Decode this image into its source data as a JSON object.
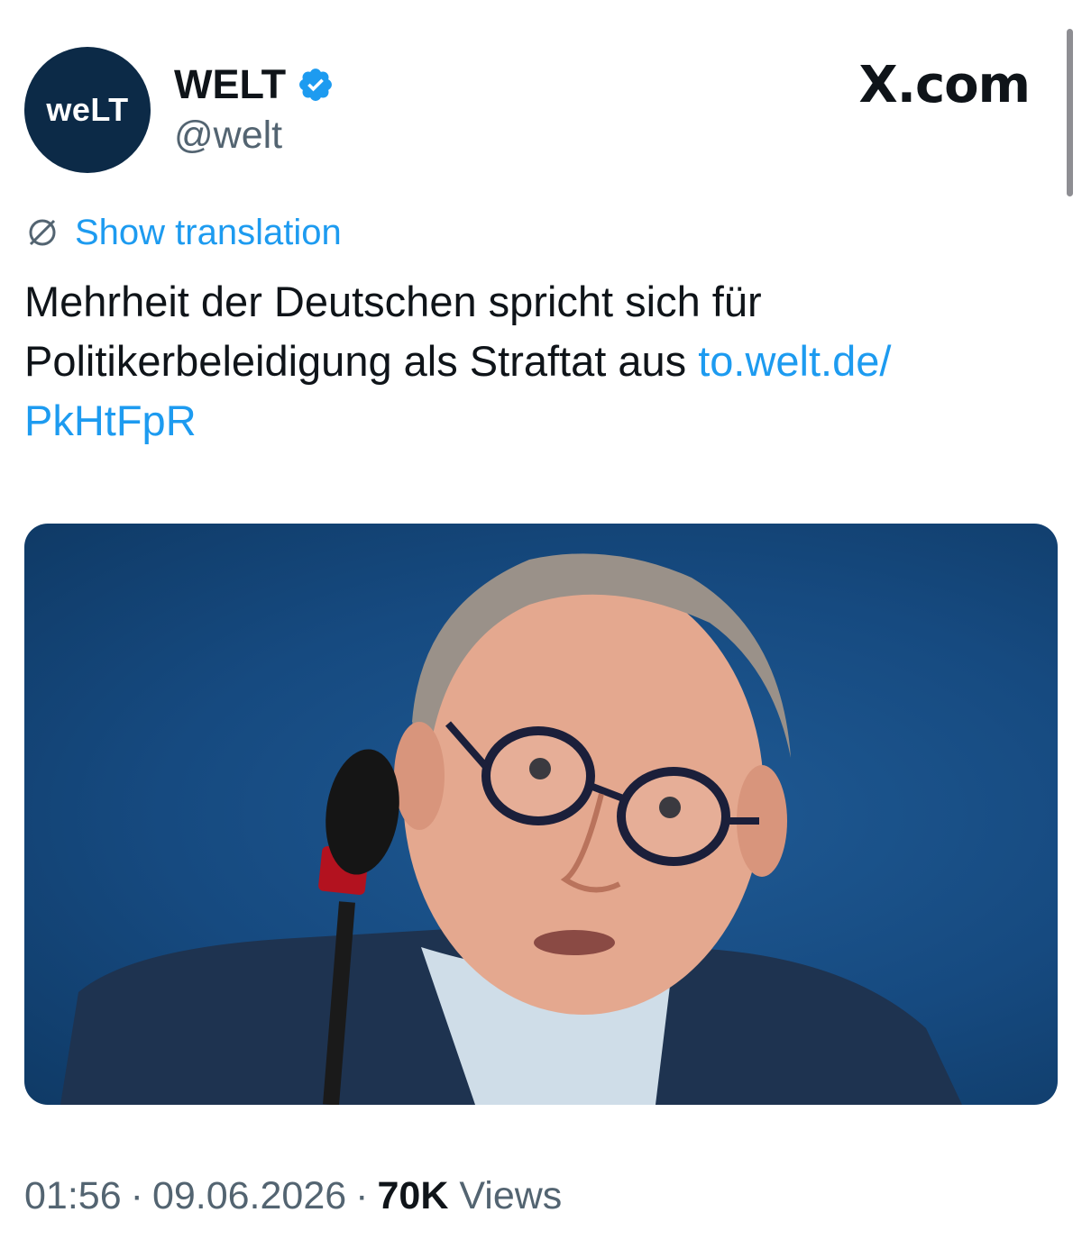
{
  "account": {
    "avatar_text": "weLT",
    "display_name": "WELT",
    "handle": "@welt",
    "verified": true
  },
  "site": {
    "label": "X.com"
  },
  "translation": {
    "label": "Show translation",
    "icon": "globe-icon"
  },
  "tweet": {
    "text": "Mehrheit der Deutschen spricht sich für Politikerbeleidigung als Straftat aus",
    "link_text": "to.welt.de/ PkHtFpR"
  },
  "meta": {
    "time": "01:56",
    "date": "09.06.2026",
    "views_count": "70K",
    "views_label": "Views"
  },
  "colors": {
    "link": "#1d9bf0",
    "secondary_text": "#536471",
    "avatar_bg": "#0c2a47",
    "verified": "#1d9bf0",
    "media_bg": "#164a80"
  }
}
